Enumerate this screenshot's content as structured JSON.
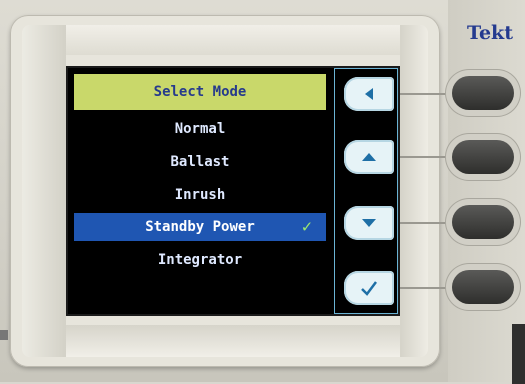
{
  "brand": {
    "text": "Tekt"
  },
  "menu": {
    "title": "Select Mode",
    "items": [
      {
        "label": "Normal",
        "selected": false
      },
      {
        "label": "Ballast",
        "selected": false
      },
      {
        "label": "Inrush",
        "selected": false
      },
      {
        "label": "Standby Power",
        "selected": true
      },
      {
        "label": "Integrator",
        "selected": false
      }
    ],
    "selected_mark": "✓"
  },
  "softkeys": [
    {
      "icon": "triangle-left-icon"
    },
    {
      "icon": "triangle-up-icon"
    },
    {
      "icon": "triangle-down-icon"
    },
    {
      "icon": "checkmark-icon"
    }
  ],
  "colors": {
    "title_bg": "#c9d86a",
    "selection_bg": "#1f56b2",
    "check_color": "#9de86f",
    "brand_color": "#243a8f"
  }
}
